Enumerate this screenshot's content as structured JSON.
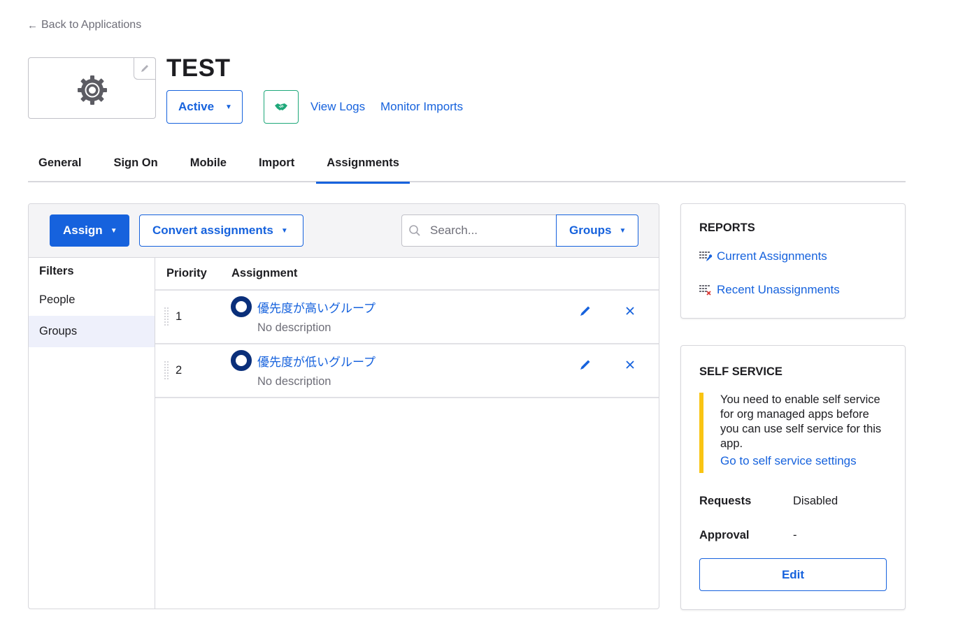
{
  "nav": {
    "back_label": "Back to Applications",
    "back_icon": "arrow-left-icon"
  },
  "app": {
    "title": "TEST",
    "logo_icon": "gear-icon",
    "status_label": "Active",
    "integration_icon": "handshake-icon",
    "integration_color": "#1fa87a",
    "links": {
      "view_logs": "View Logs",
      "monitor_imports": "Monitor Imports"
    }
  },
  "tabs": [
    {
      "label": "General",
      "active": false
    },
    {
      "label": "Sign On",
      "active": false
    },
    {
      "label": "Mobile",
      "active": false
    },
    {
      "label": "Import",
      "active": false
    },
    {
      "label": "Assignments",
      "active": true
    }
  ],
  "toolbar": {
    "assign_label": "Assign",
    "convert_label": "Convert assignments",
    "search_placeholder": "Search...",
    "search_value": "",
    "search_scope": "Groups"
  },
  "filters": {
    "title": "Filters",
    "items": [
      {
        "label": "People",
        "active": false
      },
      {
        "label": "Groups",
        "active": true
      }
    ]
  },
  "table": {
    "columns": [
      "Priority",
      "Assignment"
    ],
    "rows": [
      {
        "priority": "1",
        "name": "優先度が高いグループ",
        "description": "No description"
      },
      {
        "priority": "2",
        "name": "優先度が低いグループ",
        "description": "No description"
      }
    ]
  },
  "reports": {
    "title": "REPORTS",
    "links": [
      {
        "label": "Current Assignments",
        "icon": "report-grid-key-icon"
      },
      {
        "label": "Recent Unassignments",
        "icon": "report-grid-remove-icon"
      }
    ]
  },
  "self_service": {
    "title": "SELF SERVICE",
    "notice_text": "You need to enable self service for org managed apps before you can use self service for this app.",
    "notice_link": "Go to self service settings",
    "requests_label": "Requests",
    "requests_value": "Disabled",
    "approval_label": "Approval",
    "approval_value": "-",
    "edit_label": "Edit"
  },
  "colors": {
    "primary": "#1662dd",
    "warning": "#f9c413",
    "group_icon": "#0a2f7a",
    "danger": "#d93934"
  }
}
